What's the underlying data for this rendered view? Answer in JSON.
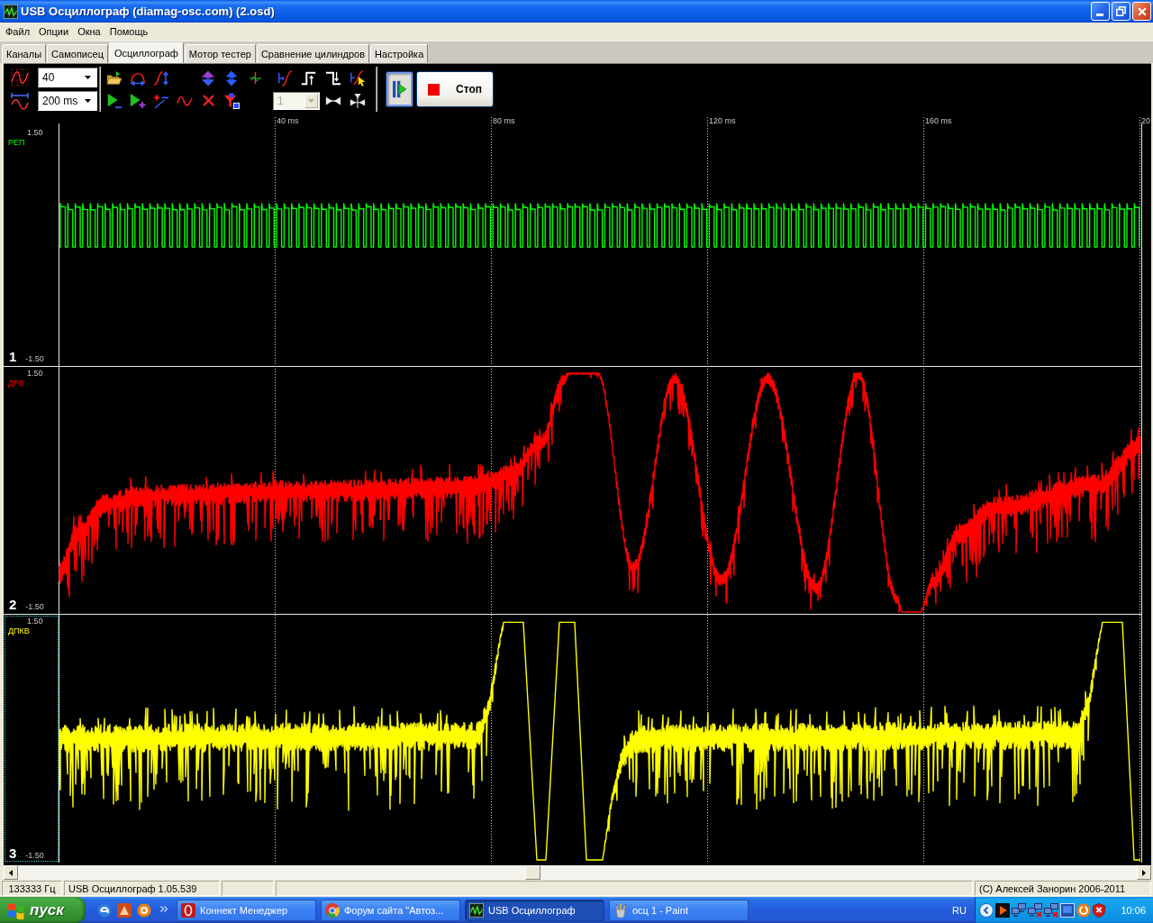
{
  "window": {
    "title": "USB Осциллограф (diamag-osc.com) (2.osd)"
  },
  "menu": [
    "Файл",
    "Опции",
    "Окна",
    "Помощь"
  ],
  "tabs": [
    {
      "label": "Каналы",
      "selected": false
    },
    {
      "label": "Самописец",
      "selected": false
    },
    {
      "label": "Осциллограф",
      "selected": true
    },
    {
      "label": "Мотор тестер",
      "selected": false
    },
    {
      "label": "Сравнение цилиндров",
      "selected": false
    },
    {
      "label": "Настройка",
      "selected": false
    }
  ],
  "toolbar": {
    "amplitude": "40",
    "timebase": "200 ms",
    "channel_combo": {
      "value": "1",
      "disabled": true
    },
    "run_button": {
      "pressed": true
    },
    "stop_button": "Стоп"
  },
  "time_axis": [
    "40 ms",
    "80 ms",
    "120 ms",
    "160 ms",
    "20"
  ],
  "channels": [
    {
      "number": "1",
      "name": "РЕП",
      "kind": "square",
      "color": "#00ff00",
      "max": "1.50",
      "min": "-1.50",
      "selected": false
    },
    {
      "number": "2",
      "name": "ДРВ",
      "kind": "resonance",
      "color": "#ff0000",
      "max": "1.50",
      "min": "-1.50",
      "selected": false
    },
    {
      "number": "3",
      "name": "ДПКВ",
      "kind": "burst",
      "color": "#ffff00",
      "max": "1.50",
      "min": "-1.50",
      "selected": true
    }
  ],
  "status_bar": {
    "frequency": "133333 Гц",
    "version": "USB Осциллограф 1.05.539",
    "copyright": "(C) Алексей Занорин 2006-2011"
  },
  "taskbar": {
    "start": "пуск",
    "tasks": [
      {
        "label": "Коннект Менеджер",
        "kind": "dialer",
        "selected": false
      },
      {
        "label": "Форум сайта \"Автоз...",
        "kind": "browser",
        "selected": false
      },
      {
        "label": "USB Осциллограф",
        "kind": "scope",
        "selected": true
      },
      {
        "label": "осц 1 - Paint",
        "kind": "paint",
        "selected": false
      }
    ],
    "language": "RU",
    "clock": "10:06"
  }
}
